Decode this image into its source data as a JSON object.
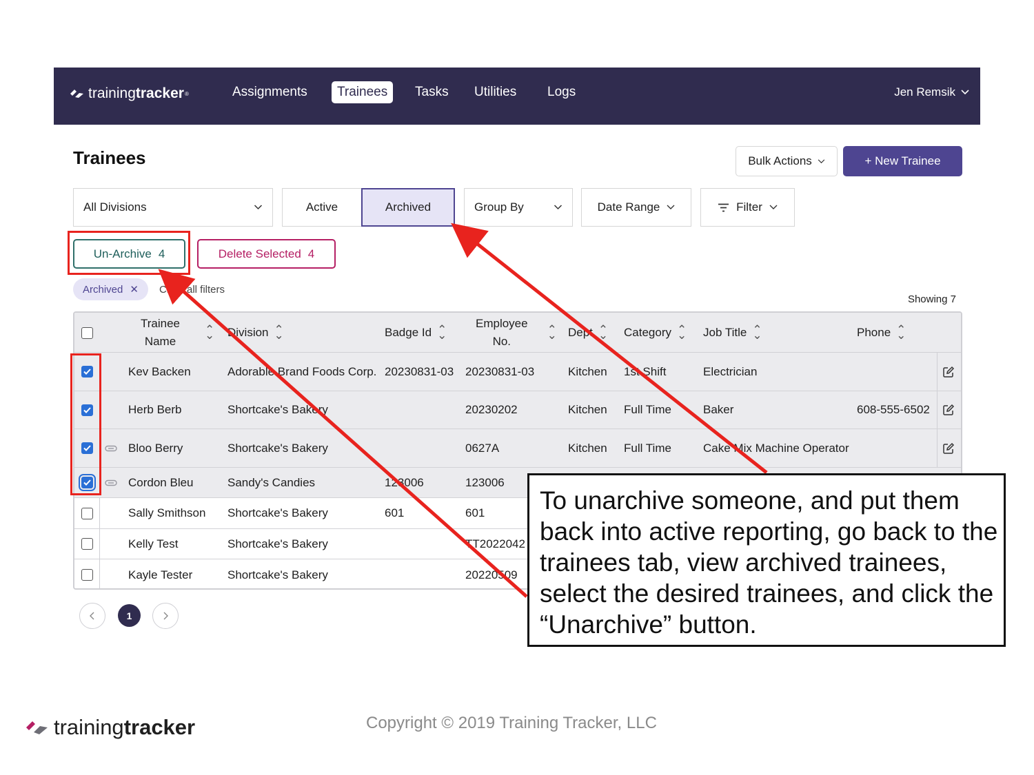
{
  "nav": {
    "brand_light": "training",
    "brand_bold": "tracker",
    "brand_mark": "®",
    "items": [
      {
        "label": "Assignments"
      },
      {
        "label": "Trainees"
      },
      {
        "label": "Tasks"
      },
      {
        "label": "Utilities"
      },
      {
        "label": "Logs"
      }
    ],
    "active_item": "Trainees",
    "user": "Jen Remsik"
  },
  "page": {
    "title": "Trainees",
    "bulk_actions": "Bulk Actions",
    "new_trainee": "+ New Trainee"
  },
  "filters": {
    "division": "All Divisions",
    "active": "Active",
    "archived": "Archived",
    "group_by": "Group By",
    "date_range": "Date Range",
    "filter": "Filter"
  },
  "selection": {
    "unarchive_label": "Un-Archive",
    "unarchive_count": "4",
    "delete_label": "Delete Selected",
    "delete_count": "4",
    "chip": "Archived",
    "clear": "Clear all filters",
    "showing": "Showing 7"
  },
  "table": {
    "headers": {
      "name_line1": "Trainee",
      "name_line2": "Name",
      "division": "Division",
      "badge": "Badge Id",
      "emp_line1": "Employee",
      "emp_line2": "No.",
      "dept": "Dept",
      "category": "Category",
      "job": "Job Title",
      "phone": "Phone"
    },
    "rows": [
      {
        "checked": true,
        "attach": false,
        "name": "Kev Backen",
        "division": "Adorable Brand Foods Corp.",
        "badge": "20230831-03",
        "emp": "20230831-03",
        "dept": "Kitchen",
        "category": "1st Shift",
        "job": "Electrician",
        "phone": ""
      },
      {
        "checked": true,
        "attach": false,
        "name": "Herb Berb",
        "division": "Shortcake's Bakery",
        "badge": "",
        "emp": "20230202",
        "dept": "Kitchen",
        "category": "Full Time",
        "job": "Baker",
        "phone": "608-555-6502"
      },
      {
        "checked": true,
        "attach": true,
        "name": "Bloo Berry",
        "division": "Shortcake's Bakery",
        "badge": "",
        "emp": "0627A",
        "dept": "Kitchen",
        "category": "Full Time",
        "job": "Cake Mix Machine Operator",
        "phone": ""
      },
      {
        "checked": true,
        "attach": true,
        "name": "Cordon Bleu",
        "division": "Sandy's Candies",
        "badge": "123006",
        "emp": "123006",
        "dept": "",
        "category": "",
        "job": "",
        "phone": ""
      },
      {
        "checked": false,
        "attach": false,
        "name": "Sally Smithson",
        "division": "Shortcake's Bakery",
        "badge": "601",
        "emp": "601",
        "dept": "",
        "category": "",
        "job": "",
        "phone": ""
      },
      {
        "checked": false,
        "attach": false,
        "name": "Kelly Test",
        "division": "Shortcake's Bakery",
        "badge": "",
        "emp": "TT2022042",
        "dept": "",
        "category": "",
        "job": "",
        "phone": ""
      },
      {
        "checked": false,
        "attach": false,
        "name": "Kayle Tester",
        "division": "Shortcake's Bakery",
        "badge": "",
        "emp": "20220509",
        "dept": "",
        "category": "",
        "job": "",
        "phone": ""
      }
    ]
  },
  "pagination": {
    "current": "1"
  },
  "annotation": {
    "callout": "To unarchive someone, and put them back into active reporting, go back to the trainees tab, view archived trainees, select the desired trainees, and click the “Unarchive” button.",
    "arrow_color": "#e8231e"
  },
  "footer": {
    "brand_light": "training",
    "brand_bold": "tracker",
    "copyright": "Copyright © 2019 Training Tracker, LLC"
  },
  "colors": {
    "nav_bg": "#302c4f",
    "primary": "#4e4591",
    "unarchive": "#2f6f6a",
    "delete": "#b51f64",
    "checkbox": "#2a6fd6"
  }
}
